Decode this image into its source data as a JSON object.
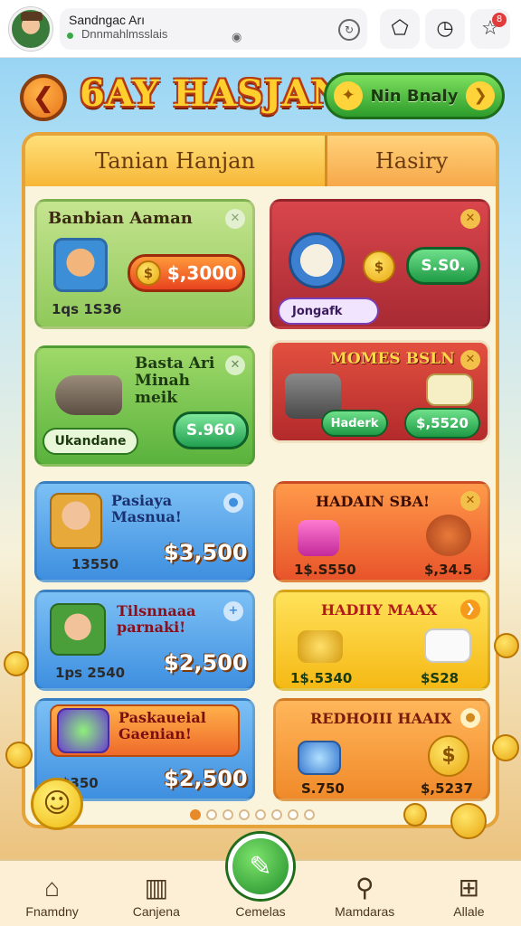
{
  "browser": {
    "title": "Sandngac Arı",
    "url": "Dnnmahlmsslais",
    "notification_count": "8"
  },
  "header": {
    "title": "6AY HASJAN",
    "action_label": "Nin Bnaly"
  },
  "tabs": [
    {
      "label": "Tanian  Hanjan"
    },
    {
      "label": "Hasiry"
    }
  ],
  "cards": {
    "c1": {
      "title": "Banbian Aaman",
      "price": "$,3000",
      "sub": "1qs 1S36"
    },
    "c2": {
      "tag": "Jongafk",
      "price": "S.S0."
    },
    "c3": {
      "title_lines": [
        "Basta Ari",
        "Minah",
        "meik"
      ],
      "button": "Ukandane",
      "price": "S.960"
    },
    "c4": {
      "title": "MOMES BSLN",
      "button": "Haderk",
      "price": "$,5520"
    },
    "c5": {
      "title_lines": [
        "Pasiaya",
        "Masnua!"
      ],
      "sub": "13550",
      "price": "$3,500"
    },
    "c6": {
      "title": "HADAIN SBA!",
      "left": "1$.S550",
      "right": "$,34.5"
    },
    "c7": {
      "title_lines": [
        "Tilsnnaaa",
        "parnaki!"
      ],
      "sub": "1ps 2540",
      "price": "$2,500"
    },
    "c8": {
      "title": "HADIIY MAAX",
      "left": "1$.5340",
      "right": "$S28"
    },
    "c9": {
      "title_lines": [
        "Paskaueial",
        "Gaenian!"
      ],
      "sub": "$350",
      "price": "$2,500"
    },
    "c10": {
      "title": "REDHOIII HAAIX",
      "left": "S.750",
      "right": "$,5237"
    }
  },
  "pager": {
    "pages": 8,
    "active": 0
  },
  "bottom_nav": [
    {
      "label": "Fnamdny",
      "icon": "home-icon"
    },
    {
      "label": "Canjena",
      "icon": "bucket-icon"
    },
    {
      "label": "Cemelas",
      "icon": "pencil-icon"
    },
    {
      "label": "Mamdaras",
      "icon": "search-icon"
    },
    {
      "label": "Allale",
      "icon": "grid-icon"
    }
  ],
  "colors": {
    "accent": "#f7b737",
    "green": "#2d9c2b",
    "red_card": "#c8323a",
    "blue_card": "#5aa6ef",
    "orange_card": "#f47a3a",
    "yellow_card": "#ffd22e"
  }
}
